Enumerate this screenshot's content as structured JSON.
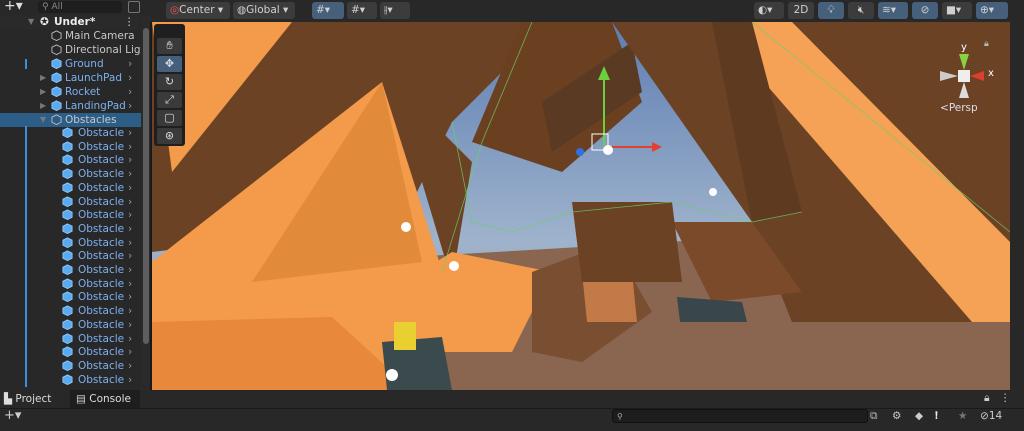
{
  "hierarchy": {
    "search_placeholder": "All",
    "scene_name": "Under*",
    "items": [
      {
        "label": "Main Camera",
        "prefab": false,
        "expandable": false
      },
      {
        "label": "Directional Lig",
        "prefab": false,
        "expandable": false
      },
      {
        "label": "Ground",
        "prefab": true,
        "expandable": false
      },
      {
        "label": "LaunchPad",
        "prefab": true,
        "expandable": true
      },
      {
        "label": "Rocket",
        "prefab": true,
        "expandable": true
      },
      {
        "label": "LandingPad",
        "prefab": true,
        "expandable": true
      },
      {
        "label": "Obstacles",
        "prefab": false,
        "expandable": true,
        "expanded": true,
        "selected": true
      }
    ],
    "children": [
      "Obstacle",
      "Obstacle",
      "Obstacle",
      "Obstacle",
      "Obstacle",
      "Obstacle",
      "Obstacle",
      "Obstacle",
      "Obstacle",
      "Obstacle",
      "Obstacle",
      "Obstacle",
      "Obstacle",
      "Obstacle",
      "Obstacle",
      "Obstacle",
      "Obstacle",
      "Obstacle",
      "Obstacle"
    ]
  },
  "toolbar": {
    "pivot": "Center",
    "space": "Global",
    "mode_2d": "2D"
  },
  "scene": {
    "projection": "Persp",
    "axis_x": "x",
    "axis_y": "y"
  },
  "bottom": {
    "tabs": [
      "Project",
      "Console"
    ],
    "hidden_count": "14"
  },
  "colors": {
    "selection": "#2c5d87",
    "prefab_text": "#7cb0f0",
    "orange": "#f39a4b",
    "sky": "#7a93b8"
  }
}
